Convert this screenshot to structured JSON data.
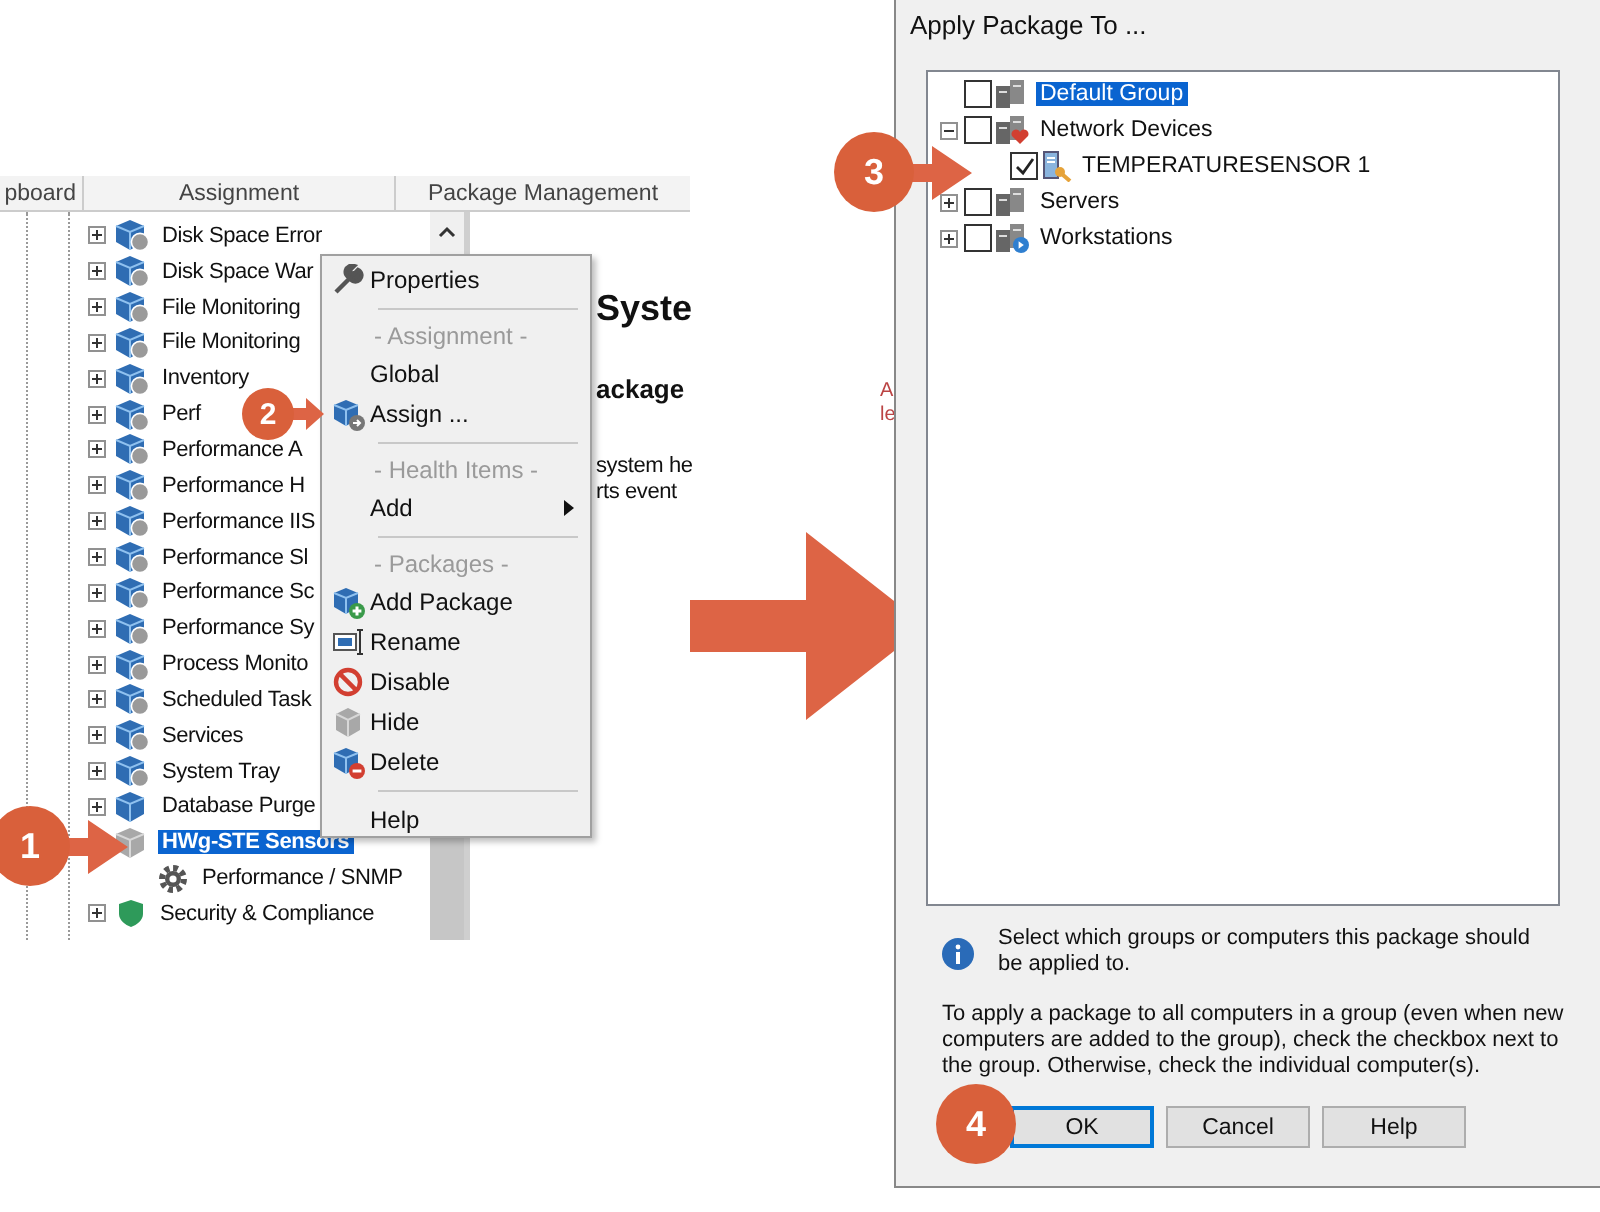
{
  "left_panel": {
    "tabs": [
      {
        "label": "pboard"
      },
      {
        "label": "Assignment"
      },
      {
        "label": "Package Management"
      }
    ],
    "tree": [
      {
        "label": "Disk Space Error",
        "kind": "monitor",
        "selected": false
      },
      {
        "label": "Disk Space War",
        "kind": "monitor",
        "selected": false
      },
      {
        "label": "File Monitoring",
        "kind": "monitor",
        "selected": false
      },
      {
        "label": "File Monitoring",
        "kind": "monitor",
        "selected": false
      },
      {
        "label": "Inventory",
        "kind": "monitor",
        "selected": false
      },
      {
        "label": "Perf",
        "kind": "monitor",
        "selected": false
      },
      {
        "label": "Performance A",
        "kind": "monitor",
        "selected": false
      },
      {
        "label": "Performance H",
        "kind": "monitor",
        "selected": false
      },
      {
        "label": "Performance IIS",
        "kind": "monitor",
        "selected": false
      },
      {
        "label": "Performance Sl",
        "kind": "monitor",
        "selected": false
      },
      {
        "label": "Performance Sc",
        "kind": "monitor",
        "selected": false
      },
      {
        "label": "Performance Sy",
        "kind": "monitor",
        "selected": false
      },
      {
        "label": "Process Monito",
        "kind": "monitor",
        "selected": false
      },
      {
        "label": "Scheduled Task",
        "kind": "monitor",
        "selected": false
      },
      {
        "label": "Services",
        "kind": "monitor",
        "selected": false
      },
      {
        "label": "System Tray",
        "kind": "monitor",
        "selected": false
      },
      {
        "label": "Database Purge",
        "kind": "package",
        "selected": false
      },
      {
        "label": "HWg-STE Sensors",
        "kind": "hidden",
        "selected": true,
        "children": [
          {
            "label": "Performance / SNMP",
            "kind": "setting",
            "selected": false
          }
        ]
      },
      {
        "label": "Security & Compliance",
        "kind": "security",
        "selected": false
      }
    ],
    "detail": {
      "title": "Syste",
      "subtitle": "ackage",
      "lines": [
        "system he",
        "rts event"
      ]
    }
  },
  "context_menu": {
    "items": [
      {
        "kind": "action",
        "label": "Properties"
      },
      {
        "kind": "separator"
      },
      {
        "kind": "header",
        "label": "- Assignment -"
      },
      {
        "kind": "action",
        "label": "Global"
      },
      {
        "kind": "action",
        "label": "Assign ..."
      },
      {
        "kind": "separator"
      },
      {
        "kind": "header",
        "label": "- Health Items -"
      },
      {
        "kind": "submenu",
        "label": "Add"
      },
      {
        "kind": "separator"
      },
      {
        "kind": "header",
        "label": "- Packages -"
      },
      {
        "kind": "action",
        "label": "Add Package"
      },
      {
        "kind": "action",
        "label": "Rename"
      },
      {
        "kind": "action",
        "label": "Disable"
      },
      {
        "kind": "action",
        "label": "Hide"
      },
      {
        "kind": "action",
        "label": "Delete"
      },
      {
        "kind": "separator"
      },
      {
        "kind": "action",
        "label": "Help"
      }
    ]
  },
  "background_window": {
    "fragments": [
      "A",
      "le"
    ]
  },
  "dialog": {
    "title": "Apply Package To ...",
    "tree": [
      {
        "label": "Default Group",
        "kind": "group",
        "checked": false,
        "selected": true
      },
      {
        "label": "Network Devices",
        "kind": "network",
        "checked": false,
        "selected": false,
        "expanded": true,
        "children": [
          {
            "label": "TEMPERATURESENSOR 1",
            "kind": "computer",
            "checked": true,
            "selected": false
          }
        ]
      },
      {
        "label": "Servers",
        "kind": "group",
        "checked": false,
        "selected": false,
        "expanded": false
      },
      {
        "label": "Workstations",
        "kind": "workstations",
        "checked": false,
        "selected": false,
        "expanded": false
      }
    ],
    "info": "Select which groups or computers this package should be applied to.",
    "note": "To apply a package to all computers in a group (even when new computers are added to the group), check the checkbox next to the group. Otherwise, check the individual computer(s).",
    "buttons": [
      {
        "label": "OK",
        "default": true
      },
      {
        "label": "Cancel",
        "default": false
      },
      {
        "label": "Help",
        "default": false
      }
    ]
  },
  "steps": [
    {
      "number": "1"
    },
    {
      "number": "2"
    },
    {
      "number": "3"
    },
    {
      "number": "4"
    }
  ]
}
